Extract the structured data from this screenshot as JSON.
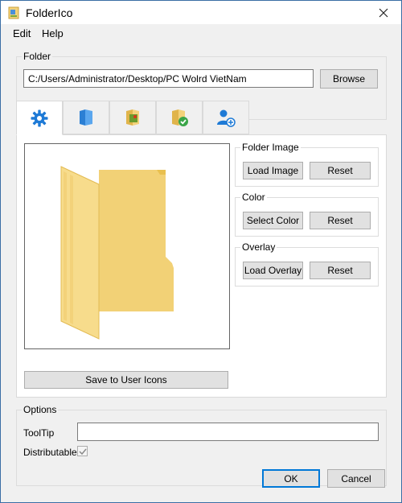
{
  "window": {
    "title": "FolderIco"
  },
  "menu": {
    "items": [
      "Edit",
      "Help"
    ]
  },
  "folder": {
    "group_title": "Folder",
    "path": "C:/Users/Administrator/Desktop/PC Wolrd VietNam",
    "browse_label": "Browse"
  },
  "tabs": [
    {
      "icon": "gear-icon",
      "active": true
    },
    {
      "icon": "folder-blue-icon",
      "active": false
    },
    {
      "icon": "folder-picture-icon",
      "active": false
    },
    {
      "icon": "folder-check-icon",
      "active": false
    },
    {
      "icon": "user-add-icon",
      "active": false
    }
  ],
  "editor": {
    "folder_image": {
      "title": "Folder Image",
      "load_label": "Load Image",
      "reset_label": "Reset"
    },
    "color": {
      "title": "Color",
      "select_label": "Select Color",
      "reset_label": "Reset"
    },
    "overlay": {
      "title": "Overlay",
      "load_label": "Load Overlay",
      "reset_label": "Reset"
    },
    "save_label": "Save to User Icons"
  },
  "options": {
    "group_title": "Options",
    "tooltip_label": "ToolTip",
    "tooltip_value": "",
    "distributable_label": "Distributable",
    "distributable_checked": true
  },
  "footer": {
    "ok_label": "OK",
    "cancel_label": "Cancel"
  },
  "colors": {
    "accent": "#0078d7",
    "folder": "#f3d27a",
    "frame": "#3a6ea5"
  }
}
